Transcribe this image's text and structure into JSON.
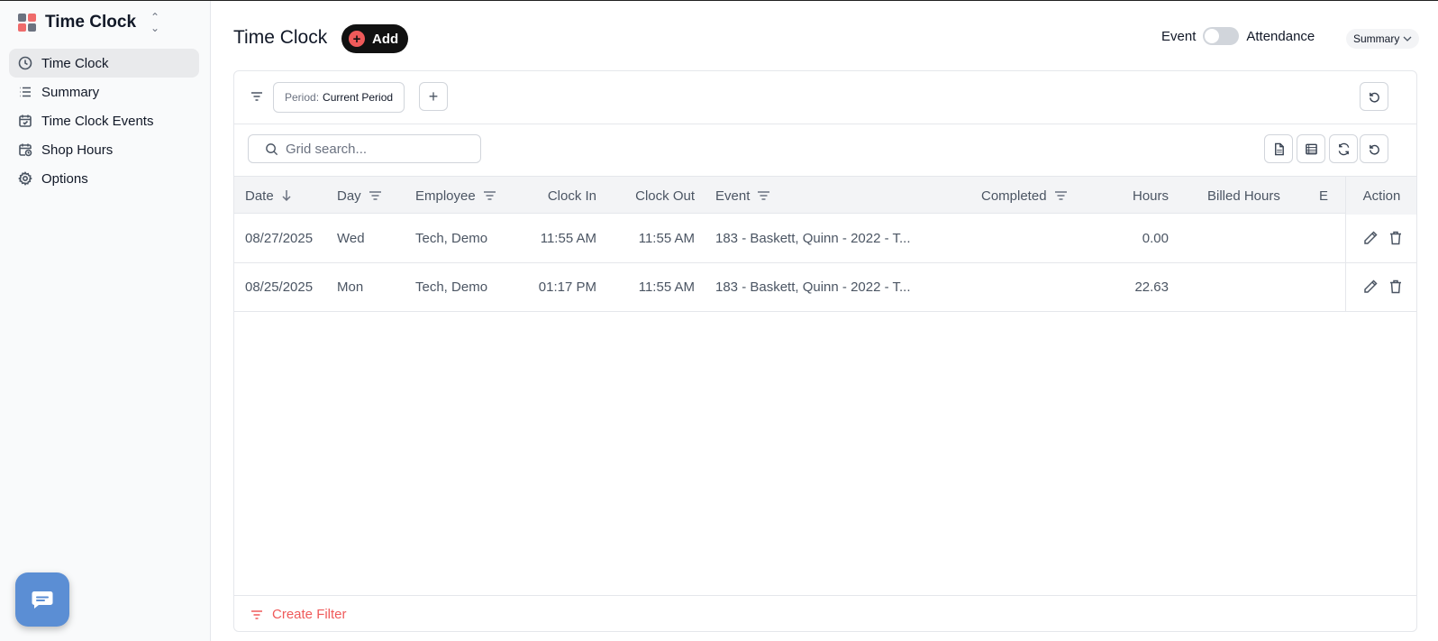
{
  "sidebar": {
    "app_title": "Time Clock",
    "items": [
      {
        "label": "Time Clock",
        "icon": "clock-icon",
        "active": true
      },
      {
        "label": "Summary",
        "icon": "list-icon",
        "active": false
      },
      {
        "label": "Time Clock Events",
        "icon": "calendar-check-icon",
        "active": false
      },
      {
        "label": "Shop Hours",
        "icon": "calendar-clock-icon",
        "active": false
      },
      {
        "label": "Options",
        "icon": "gear-icon",
        "active": false
      }
    ]
  },
  "header": {
    "title": "Time Clock",
    "add_label": "Add",
    "toggle_left": "Event",
    "toggle_right": "Attendance",
    "view_select": "Summary"
  },
  "filters": {
    "period_key": "Period:",
    "period_value": "Current Period"
  },
  "search": {
    "placeholder": "Grid search..."
  },
  "table": {
    "columns": [
      "Date",
      "Day",
      "Employee",
      "Clock In",
      "Clock Out",
      "Event",
      "Completed",
      "Hours",
      "Billed Hours",
      "E",
      "Action"
    ],
    "rows": [
      {
        "date": "08/27/2025",
        "day": "Wed",
        "employee": "Tech, Demo",
        "clock_in": "11:55 AM",
        "clock_out": "11:55 AM",
        "event": "183 - Baskett, Quinn - 2022 - T...",
        "completed": "",
        "hours": "0.00",
        "billed_hours": ""
      },
      {
        "date": "08/25/2025",
        "day": "Mon",
        "employee": "Tech, Demo",
        "clock_in": "01:17 PM",
        "clock_out": "11:55 AM",
        "event": "183 - Baskett, Quinn - 2022 - T...",
        "completed": "",
        "hours": "22.63",
        "billed_hours": ""
      }
    ]
  },
  "footer": {
    "create_filter": "Create Filter"
  },
  "colors": {
    "accent": "#ef5a5a",
    "dark": "#111111",
    "chat": "#5b8ed4"
  }
}
